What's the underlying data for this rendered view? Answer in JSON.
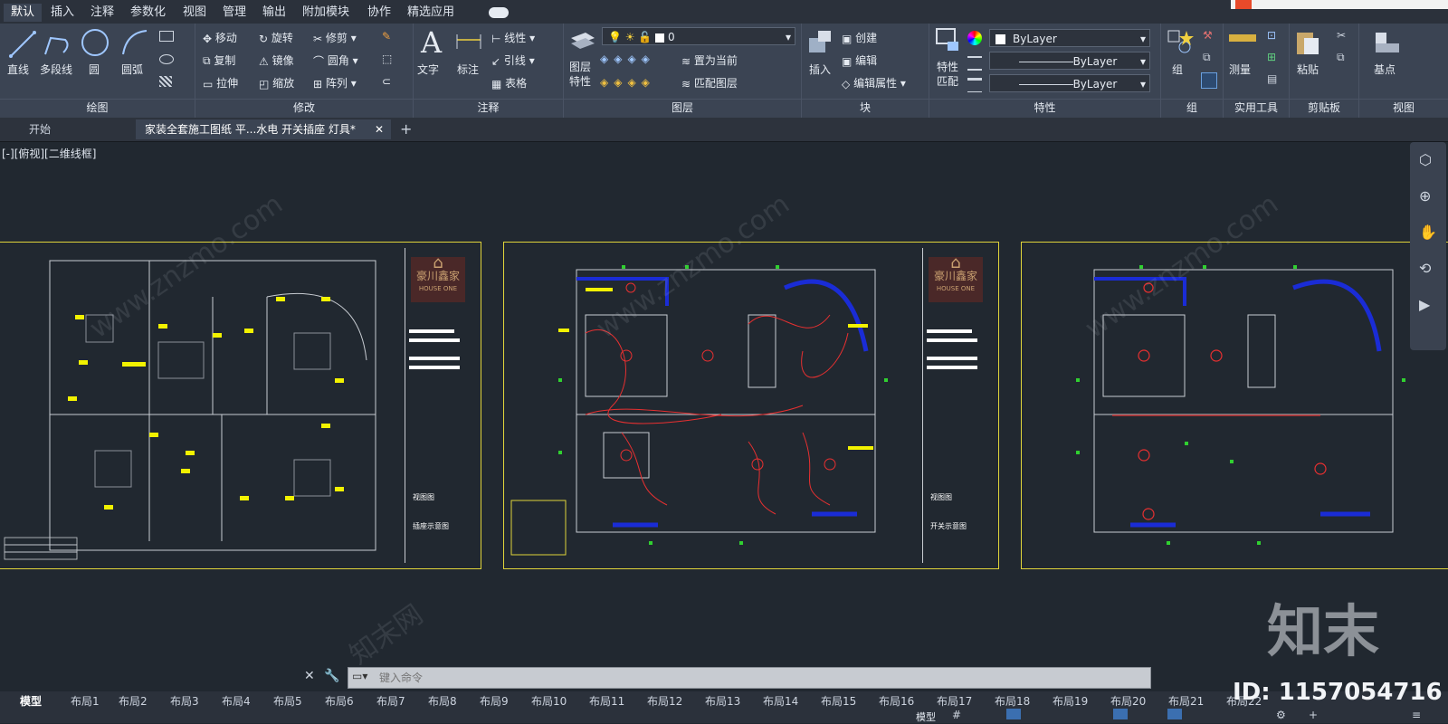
{
  "ribbon_tabs": [
    "默认",
    "插入",
    "注释",
    "参数化",
    "视图",
    "管理",
    "输出",
    "附加模块",
    "协作",
    "精选应用"
  ],
  "draw_panel": {
    "title": "绘图",
    "line": "直线",
    "polyline": "多段线",
    "circle": "圆",
    "arc": "圆弧"
  },
  "modify_panel": {
    "title": "修改",
    "move": "移动",
    "rotate": "旋转",
    "trim": "修剪",
    "copy": "复制",
    "mirror": "镜像",
    "fillet": "圆角",
    "stretch": "拉伸",
    "scale": "缩放",
    "array": "阵列"
  },
  "annotation_panel": {
    "title": "注释",
    "text": "文字",
    "dimension": "标注",
    "linear": "线性",
    "leader": "引线",
    "table": "表格"
  },
  "layers_panel": {
    "title": "图层",
    "properties": "图层\n特性",
    "layer_value": "0",
    "set_current": "置为当前",
    "match_layer": "匹配图层"
  },
  "block_panel": {
    "title": "块",
    "insert": "插入",
    "create": "创建",
    "edit": "编辑",
    "edit_attributes": "编辑属性"
  },
  "properties_panel": {
    "title": "特性",
    "match": "特性\n匹配",
    "color": "ByLayer",
    "linetype": "ByLayer",
    "lineweight": "ByLayer"
  },
  "groups_panel": {
    "title": "组",
    "group": "组"
  },
  "utilities_panel": {
    "title": "实用工具",
    "measure": "测量"
  },
  "clipboard_panel": {
    "title": "剪贴板",
    "paste": "粘贴"
  },
  "view_panel": {
    "title": "视图",
    "base": "基点"
  },
  "doc_tabs": {
    "start": "开始",
    "active": "家装全套施工图纸 平...水电 开关插座 灯具*"
  },
  "viewport_label": "[-][俯视][二维线框]",
  "sheets": [
    {
      "logo": "豪川鑫家",
      "logo_sub": "HOUSE ONE",
      "title1": "视图图",
      "title2": "插座示意图"
    },
    {
      "logo": "豪川鑫家",
      "logo_sub": "HOUSE ONE",
      "title1": "视图图",
      "title2": "开关示意图"
    }
  ],
  "command_placeholder": "键入命令",
  "layout_tabs": [
    "模型",
    "布局1",
    "布局2",
    "布局3",
    "布局4",
    "布局5",
    "布局6",
    "布局7",
    "布局8",
    "布局9",
    "布局10",
    "布局11",
    "布局12",
    "布局13",
    "布局14",
    "布局15",
    "布局16",
    "布局17",
    "布局18",
    "布局19",
    "布局20",
    "布局21",
    "布局22"
  ],
  "status_model": "模型",
  "watermark": "知末",
  "watermark_id": "ID: 1157054716",
  "watermark_url": "www.znzmo.com",
  "watermark_cn": "知末网"
}
